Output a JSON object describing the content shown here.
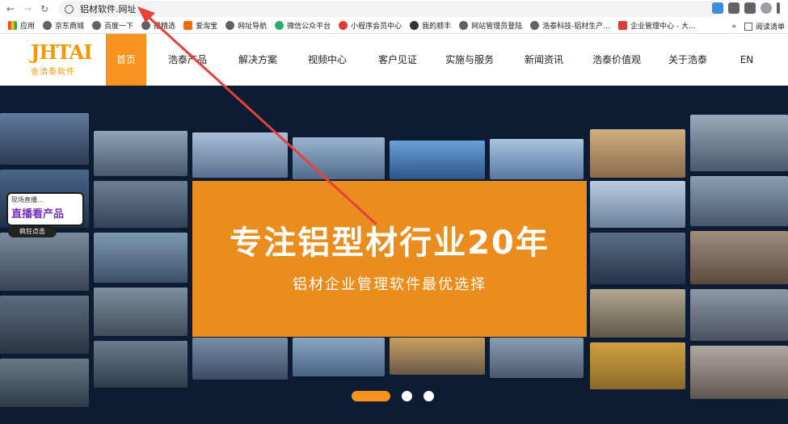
{
  "browser": {
    "url": "铝材软件.网址",
    "bookmarks": [
      {
        "label": "应用",
        "color": "#4285f4"
      },
      {
        "label": "京东商城",
        "color": "#5f6368"
      },
      {
        "label": "百度一下",
        "color": "#5f6368"
      },
      {
        "label": "播精选",
        "color": "#5f6368"
      },
      {
        "label": "爱淘宝",
        "color": "#ff6a00"
      },
      {
        "label": "网址导航",
        "color": "#5f6368"
      },
      {
        "label": "微信公众平台",
        "color": "#2aae67"
      },
      {
        "label": "小程序会员中心",
        "color": "#e53935"
      },
      {
        "label": "我的顺丰",
        "color": "#333333"
      },
      {
        "label": "网站管理员登陆",
        "color": "#5f6368"
      },
      {
        "label": "浩泰科技-铝材生产...",
        "color": "#5f6368"
      },
      {
        "label": "企业管理中心 - 大...",
        "color": "#e53935"
      }
    ],
    "more": "»",
    "reading_list": "阅读清单"
  },
  "site": {
    "logo_mark": "JHTAI",
    "logo_tag": "金浩泰软件",
    "menu": [
      {
        "label": "首页",
        "active": true
      },
      {
        "label": "浩泰产品",
        "active": false
      },
      {
        "label": "解决方案",
        "active": false
      },
      {
        "label": "视频中心",
        "active": false
      },
      {
        "label": "客户见证",
        "active": false
      },
      {
        "label": "实施与服务",
        "active": false
      },
      {
        "label": "新闻资讯",
        "active": false
      },
      {
        "label": "浩泰价值观",
        "active": false
      },
      {
        "label": "关于浩泰",
        "active": false
      },
      {
        "label": "EN",
        "active": false
      }
    ]
  },
  "hero": {
    "title": "专注铝型材行业20年",
    "subtitle": "铝材企业管理软件最优选择",
    "live_line1": "现场直播...",
    "live_line2": "直播看产品",
    "live_pill": "疯狂点击",
    "slides": 3,
    "active_slide": 1
  },
  "colors": {
    "accent": "#f7931e",
    "hero_bg": "#0d1b33",
    "annotation_arrow": "#e8403a"
  }
}
